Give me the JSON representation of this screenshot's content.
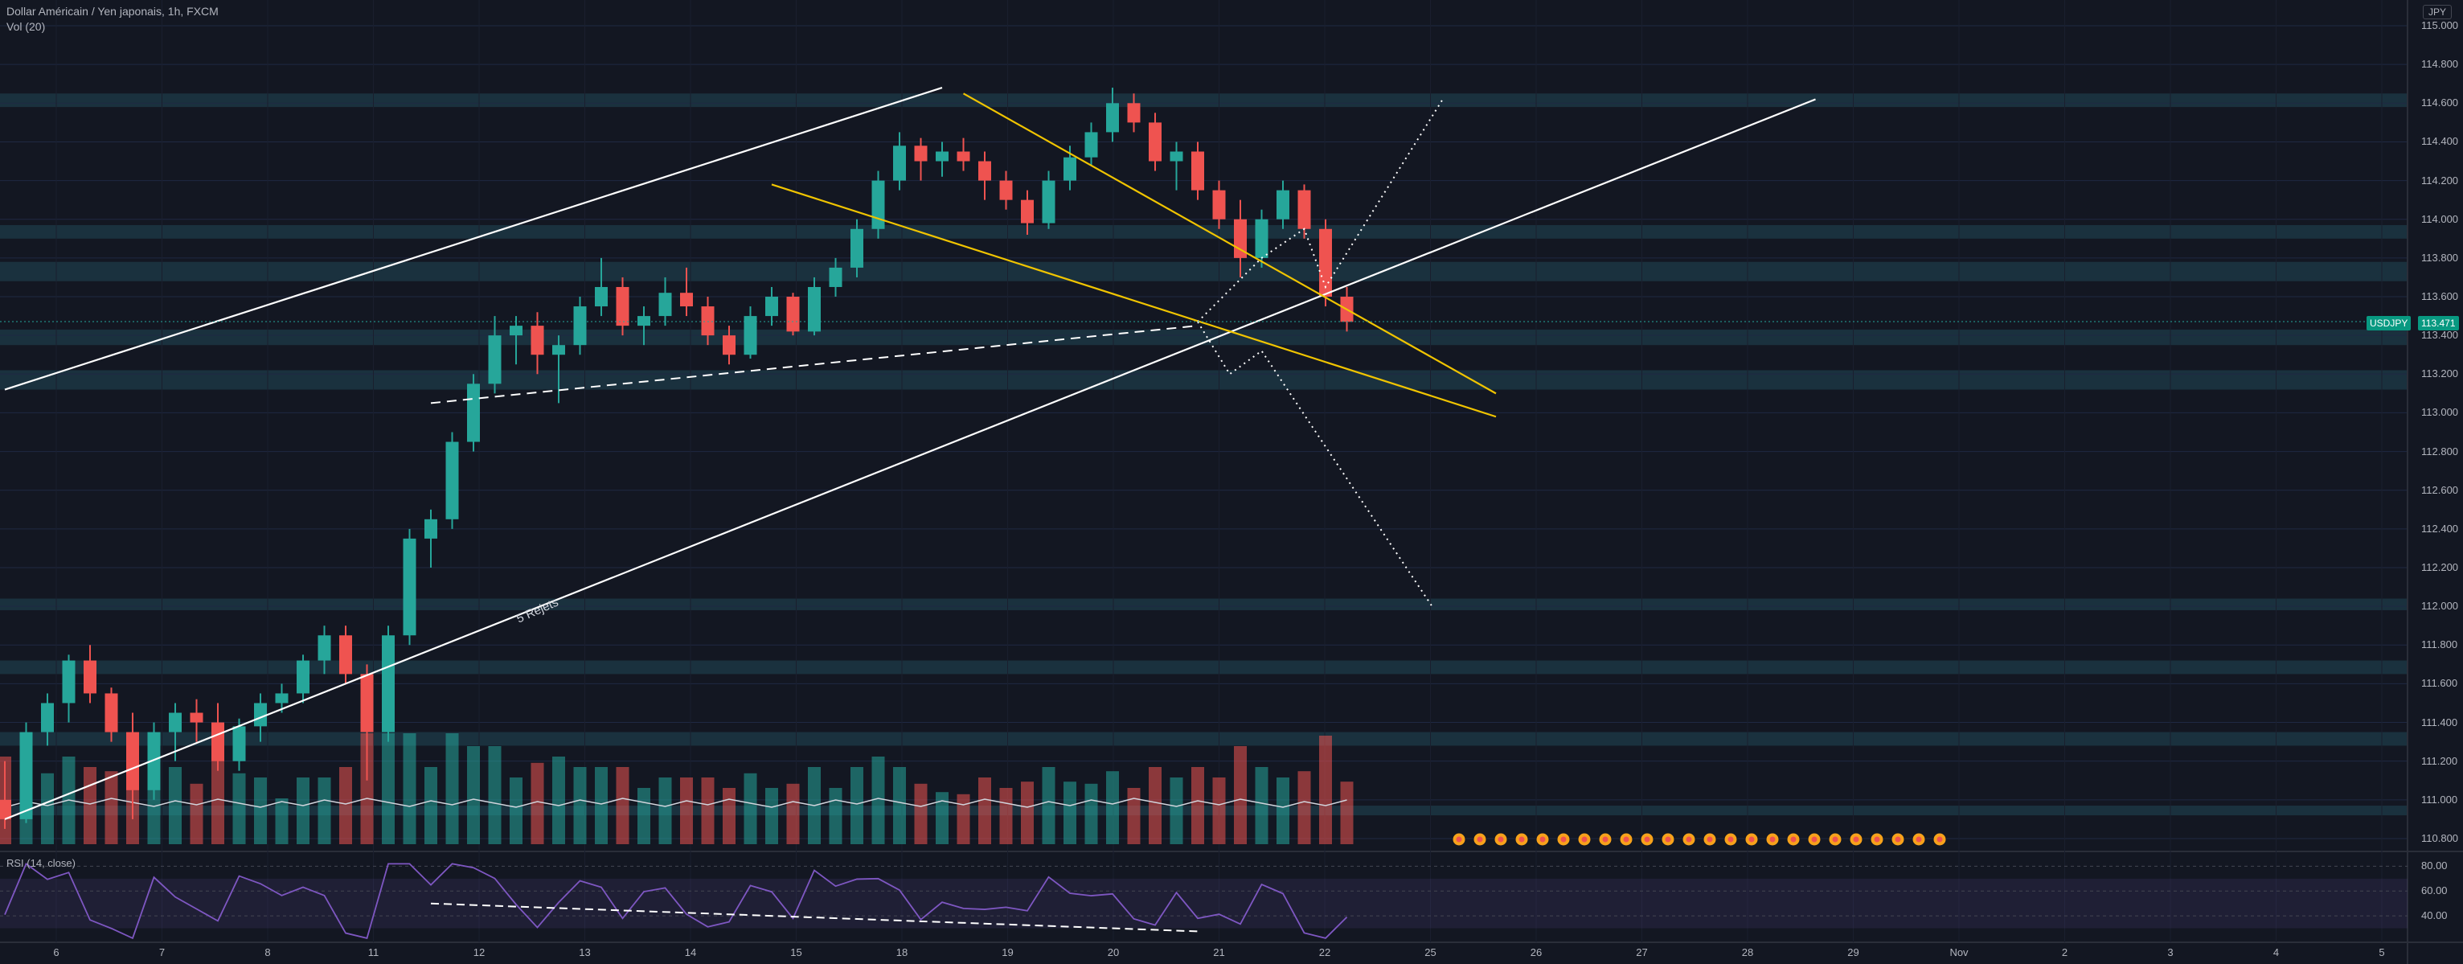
{
  "header": {
    "title": "Dollar Américain / Yen japonais, 1h, FXCM",
    "volume_label": "Vol (20)"
  },
  "currency_box": "JPY",
  "price_axis": [
    "115.000",
    "114.800",
    "114.600",
    "114.400",
    "114.200",
    "114.000",
    "113.800",
    "113.600",
    "113.400",
    "113.200",
    "113.000",
    "112.800",
    "112.600",
    "112.400",
    "112.200",
    "112.000",
    "111.800",
    "111.600",
    "111.400",
    "111.200",
    "111.000",
    "110.800"
  ],
  "rsi_axis": [
    "80.00",
    "60.00",
    "40.00"
  ],
  "rsi_label": "RSI (14, close)",
  "time_axis": [
    "6",
    "7",
    "8",
    "11",
    "12",
    "13",
    "14",
    "15",
    "18",
    "19",
    "20",
    "21",
    "22",
    "25",
    "26",
    "27",
    "28",
    "29",
    "Nov",
    "2",
    "3",
    "4",
    "5"
  ],
  "last_price": {
    "symbol": "USDJPY",
    "value": "113.471"
  },
  "annotation": "5 Rejets",
  "colors": {
    "background": "#131722",
    "up": "#26a69a",
    "down": "#ef5350",
    "wedge": "#f0c400",
    "channel": "#ffffff",
    "rsi": "#7e57c2",
    "zone": "#1e3b48"
  },
  "chart_data": {
    "type": "candlestick",
    "symbol": "USDJPY",
    "interval": "1h",
    "ylim": [
      110.75,
      115.05
    ],
    "rsi_ylim": [
      20,
      90
    ],
    "candles": [
      [
        111.0,
        111.2,
        110.85,
        110.9
      ],
      [
        110.9,
        111.4,
        110.88,
        111.35
      ],
      [
        111.35,
        111.55,
        111.28,
        111.5
      ],
      [
        111.5,
        111.75,
        111.4,
        111.72
      ],
      [
        111.72,
        111.8,
        111.5,
        111.55
      ],
      [
        111.55,
        111.58,
        111.3,
        111.35
      ],
      [
        111.35,
        111.45,
        110.9,
        111.05
      ],
      [
        111.05,
        111.4,
        111.0,
        111.35
      ],
      [
        111.35,
        111.5,
        111.2,
        111.45
      ],
      [
        111.45,
        111.52,
        111.3,
        111.4
      ],
      [
        111.4,
        111.5,
        111.15,
        111.2
      ],
      [
        111.2,
        111.42,
        111.15,
        111.38
      ],
      [
        111.38,
        111.55,
        111.3,
        111.5
      ],
      [
        111.5,
        111.6,
        111.45,
        111.55
      ],
      [
        111.55,
        111.75,
        111.5,
        111.72
      ],
      [
        111.72,
        111.9,
        111.65,
        111.85
      ],
      [
        111.85,
        111.9,
        111.6,
        111.65
      ],
      [
        111.65,
        111.7,
        111.1,
        111.35
      ],
      [
        111.35,
        111.9,
        111.3,
        111.85
      ],
      [
        111.85,
        112.4,
        111.8,
        112.35
      ],
      [
        112.35,
        112.5,
        112.2,
        112.45
      ],
      [
        112.45,
        112.9,
        112.4,
        112.85
      ],
      [
        112.85,
        113.2,
        112.8,
        113.15
      ],
      [
        113.15,
        113.5,
        113.1,
        113.4
      ],
      [
        113.4,
        113.5,
        113.25,
        113.45
      ],
      [
        113.45,
        113.52,
        113.2,
        113.3
      ],
      [
        113.3,
        113.4,
        113.05,
        113.35
      ],
      [
        113.35,
        113.6,
        113.3,
        113.55
      ],
      [
        113.55,
        113.8,
        113.5,
        113.65
      ],
      [
        113.65,
        113.7,
        113.4,
        113.45
      ],
      [
        113.45,
        113.55,
        113.35,
        113.5
      ],
      [
        113.5,
        113.7,
        113.45,
        113.62
      ],
      [
        113.62,
        113.75,
        113.5,
        113.55
      ],
      [
        113.55,
        113.6,
        113.35,
        113.4
      ],
      [
        113.4,
        113.45,
        113.25,
        113.3
      ],
      [
        113.3,
        113.55,
        113.28,
        113.5
      ],
      [
        113.5,
        113.65,
        113.45,
        113.6
      ],
      [
        113.6,
        113.62,
        113.4,
        113.42
      ],
      [
        113.42,
        113.7,
        113.4,
        113.65
      ],
      [
        113.65,
        113.8,
        113.6,
        113.75
      ],
      [
        113.75,
        114.0,
        113.7,
        113.95
      ],
      [
        113.95,
        114.25,
        113.9,
        114.2
      ],
      [
        114.2,
        114.45,
        114.15,
        114.38
      ],
      [
        114.38,
        114.42,
        114.2,
        114.3
      ],
      [
        114.3,
        114.4,
        114.22,
        114.35
      ],
      [
        114.35,
        114.42,
        114.25,
        114.3
      ],
      [
        114.3,
        114.35,
        114.1,
        114.2
      ],
      [
        114.2,
        114.25,
        114.05,
        114.1
      ],
      [
        114.1,
        114.15,
        113.92,
        113.98
      ],
      [
        113.98,
        114.25,
        113.95,
        114.2
      ],
      [
        114.2,
        114.38,
        114.15,
        114.32
      ],
      [
        114.32,
        114.5,
        114.28,
        114.45
      ],
      [
        114.45,
        114.68,
        114.4,
        114.6
      ],
      [
        114.6,
        114.65,
        114.45,
        114.5
      ],
      [
        114.5,
        114.55,
        114.25,
        114.3
      ],
      [
        114.3,
        114.4,
        114.15,
        114.35
      ],
      [
        114.35,
        114.4,
        114.1,
        114.15
      ],
      [
        114.15,
        114.2,
        113.95,
        114.0
      ],
      [
        114.0,
        114.1,
        113.7,
        113.8
      ],
      [
        113.8,
        114.05,
        113.75,
        114.0
      ],
      [
        114.0,
        114.2,
        113.95,
        114.15
      ],
      [
        114.15,
        114.18,
        113.9,
        113.95
      ],
      [
        113.95,
        114.0,
        113.55,
        113.6
      ],
      [
        113.6,
        113.65,
        113.42,
        113.47
      ]
    ],
    "volume_ma_period": 20,
    "channel_upper": [
      [
        0.0,
        113.12
      ],
      [
        44.0,
        114.68
      ]
    ],
    "channel_lower": [
      [
        0.0,
        110.9
      ],
      [
        85.0,
        114.62
      ]
    ],
    "wedge_upper": [
      [
        45.0,
        114.65
      ],
      [
        70.0,
        113.1
      ]
    ],
    "wedge_lower": [
      [
        36.0,
        114.18
      ],
      [
        70.0,
        112.98
      ]
    ],
    "support_dashed": [
      [
        20.0,
        113.05
      ],
      [
        56.0,
        113.45
      ]
    ],
    "projection_up": [
      [
        56.0,
        113.47
      ],
      [
        59.0,
        113.8
      ],
      [
        61.0,
        113.95
      ],
      [
        62.0,
        113.65
      ],
      [
        67.5,
        114.62
      ]
    ],
    "projection_down": [
      [
        56.0,
        113.47
      ],
      [
        57.5,
        113.2
      ],
      [
        59.0,
        113.32
      ],
      [
        67.0,
        112.0
      ]
    ],
    "horizontal_zones": [
      [
        114.58,
        114.65
      ],
      [
        113.9,
        113.97
      ],
      [
        113.68,
        113.78
      ],
      [
        113.35,
        113.43
      ],
      [
        113.12,
        113.22
      ],
      [
        111.98,
        112.04
      ],
      [
        111.65,
        111.72
      ],
      [
        111.28,
        111.35
      ],
      [
        110.92,
        110.97
      ]
    ],
    "rsi_dashed": [
      [
        20.0,
        50.0
      ],
      [
        56.0,
        27.5
      ]
    ],
    "event_markers": 24
  }
}
